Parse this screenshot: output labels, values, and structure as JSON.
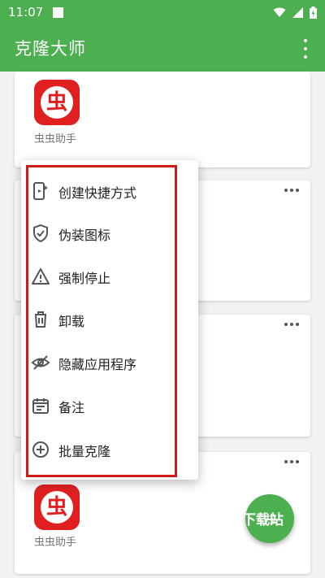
{
  "status_bar": {
    "time": "11:07",
    "icons": [
      "square-notification-icon",
      "wifi-icon",
      "signal-icon",
      "battery-icon"
    ]
  },
  "app_bar": {
    "title": "克隆大师",
    "overflow_icon": "more-vert-icon"
  },
  "cards": [
    {
      "app_name": "虫虫助手",
      "icon_glyph": "虫"
    },
    {
      "app_name": ""
    },
    {
      "app_name": ""
    },
    {
      "app_name": "虫虫助手",
      "icon_glyph": "虫"
    }
  ],
  "context_menu": {
    "items": [
      {
        "label": "创建快捷方式",
        "icon": "shortcut-icon"
      },
      {
        "label": "伪装图标",
        "icon": "shield-icon"
      },
      {
        "label": "强制停止",
        "icon": "warning-icon"
      },
      {
        "label": "卸载",
        "icon": "trash-icon"
      },
      {
        "label": "隐藏应用程序",
        "icon": "eye-off-icon"
      },
      {
        "label": "备注",
        "icon": "calendar-note-icon"
      },
      {
        "label": "批量克隆",
        "icon": "add-circle-icon"
      }
    ]
  },
  "fab": {
    "label": "下载站",
    "icon": "plus-icon"
  },
  "colors": {
    "primary": "#4caf50",
    "annotation_red": "#d11a1a",
    "app_icon_red": "#e02020"
  }
}
